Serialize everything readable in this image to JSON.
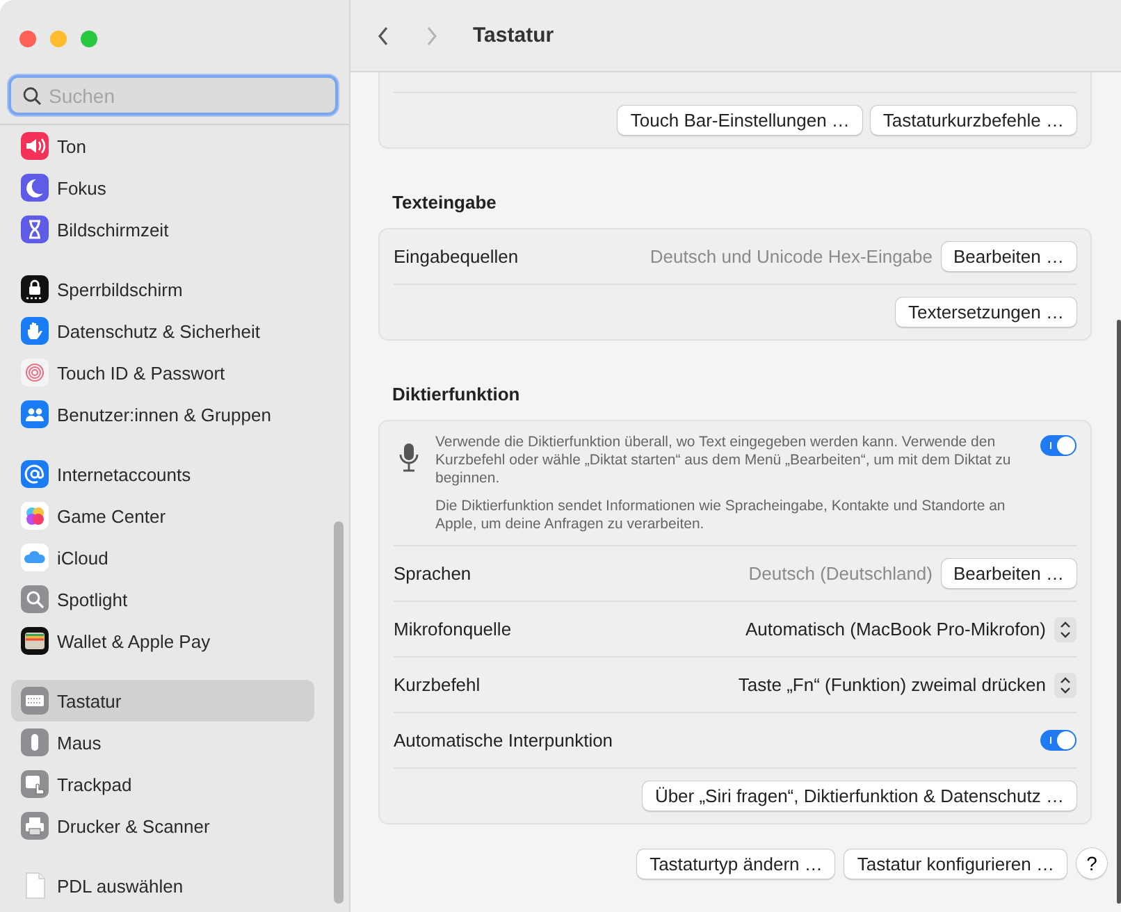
{
  "window": {
    "title": "Tastatur"
  },
  "navigation": {
    "back": {
      "disabled": false
    },
    "forward": {
      "disabled": true
    }
  },
  "search": {
    "placeholder": "Suchen"
  },
  "sidebar": {
    "groups": [
      {
        "items": [
          {
            "label": "Ton",
            "selected": false
          },
          {
            "label": "Fokus",
            "selected": false
          },
          {
            "label": "Bildschirmzeit",
            "selected": false
          }
        ]
      },
      {
        "items": [
          {
            "label": "Sperrbildschirm",
            "selected": false
          },
          {
            "label": "Datenschutz & Sicherheit",
            "selected": false
          },
          {
            "label": "Touch ID & Passwort",
            "selected": false
          },
          {
            "label": "Benutzer:innen & Gruppen",
            "selected": false
          }
        ]
      },
      {
        "items": [
          {
            "label": "Internetaccounts",
            "selected": false
          },
          {
            "label": "Game Center",
            "selected": false
          },
          {
            "label": "iCloud",
            "selected": false
          },
          {
            "label": "Spotlight",
            "selected": false
          },
          {
            "label": "Wallet & Apple Pay",
            "selected": false
          }
        ]
      },
      {
        "items": [
          {
            "label": "Tastatur",
            "selected": true
          },
          {
            "label": "Maus",
            "selected": false
          },
          {
            "label": "Trackpad",
            "selected": false
          },
          {
            "label": "Drucker & Scanner",
            "selected": false
          }
        ]
      },
      {
        "items": [
          {
            "label": "PDL auswählen",
            "selected": false
          }
        ]
      }
    ]
  },
  "sections": [
    {
      "rows": [
        {
          "kind": "buttons",
          "buttons": [
            "Touch Bar-Einstellungen …",
            "Tastaturkurzbefehle …"
          ]
        }
      ]
    },
    {
      "heading": "Texteingabe",
      "rows": [
        {
          "kind": "value_button",
          "label": "Eingabequellen",
          "value": "Deutsch und Unicode Hex-Eingabe",
          "button": "Bearbeiten …"
        },
        {
          "kind": "buttons",
          "buttons": [
            "Textersetzungen …"
          ]
        }
      ]
    },
    {
      "heading": "Diktierfunktion",
      "rows": [
        {
          "kind": "info",
          "paragraphs": [
            "Verwende die Diktierfunktion überall, wo Text eingegeben werden kann. Verwende den Kurzbefehl oder wähle „Diktat starten“ aus dem Menü „Bearbeiten“, um mit dem Diktat zu beginnen.",
            "Die Diktierfunktion sendet Informationen wie Spracheingabe, Kontakte und Standorte an Apple, um deine Anfragen zu verarbeiten."
          ],
          "on": true
        },
        {
          "kind": "value_button",
          "label": "Sprachen",
          "value": "Deutsch (Deutschland)",
          "button": "Bearbeiten …"
        },
        {
          "kind": "popup",
          "label": "Mikrofonquelle",
          "value": "Automatisch (MacBook Pro-Mikrofon)"
        },
        {
          "kind": "popup",
          "label": "Kurzbefehl",
          "value": "Taste „Fn“ (Funktion) zweimal drücken"
        },
        {
          "kind": "toggle",
          "label": "Automatische Interpunktion",
          "on": true
        },
        {
          "kind": "buttons",
          "buttons": [
            "Über „Siri fragen“, Diktierfunktion & Datenschutz …"
          ]
        }
      ]
    }
  ],
  "footer": {
    "buttons": [
      "Tastaturtyp ändern …",
      "Tastatur konfigurieren …"
    ],
    "help": "?"
  }
}
